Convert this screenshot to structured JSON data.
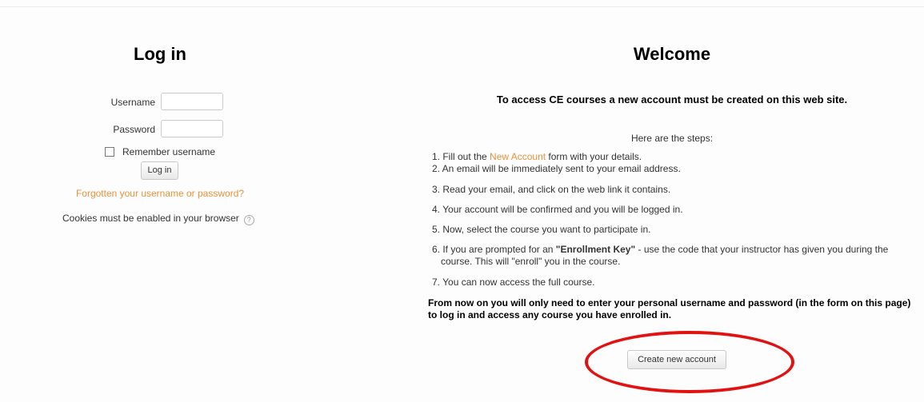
{
  "login": {
    "title": "Log in",
    "username_label": "Username",
    "username_value": "",
    "password_label": "Password",
    "password_value": "",
    "remember_label": "Remember username",
    "remember_checked": false,
    "login_button": "Log in",
    "forgot_link": "Forgotten your username or password?",
    "cookies_note": "Cookies must be enabled in your browser",
    "help_icon": "help-circle-icon"
  },
  "welcome": {
    "title": "Welcome",
    "subtitle": "To access CE courses  a new account must be created on this web site.",
    "steps_intro": "Here are the steps:",
    "step1_before": "1. Fill out the ",
    "step1_link": "New Account",
    "step1_after": " form with your details.",
    "step2": "2. An email will be immediately sent to your email address.",
    "step3": "3. Read your email, and click on the web link it contains.",
    "step4": "4. Your account will be confirmed and you will be logged in.",
    "step5": "5. Now, select the course you want to participate in.",
    "step6_before": "6. If you are prompted for an ",
    "step6_bold": "\"Enrollment Key\"",
    "step6_after": " - use the code that your instructor has given you during the",
    "step6_line2": "course. This will \"enroll\" you in the course.",
    "step7": "7. You can now access the full course.",
    "final_line1": "From now on you will only need to enter your personal username and password (in the form on this page)",
    "final_line2": "to log in and access any course you have enrolled in.",
    "create_button": "Create new account"
  },
  "colors": {
    "link": "#e8923c",
    "highlight": "#e21212"
  }
}
